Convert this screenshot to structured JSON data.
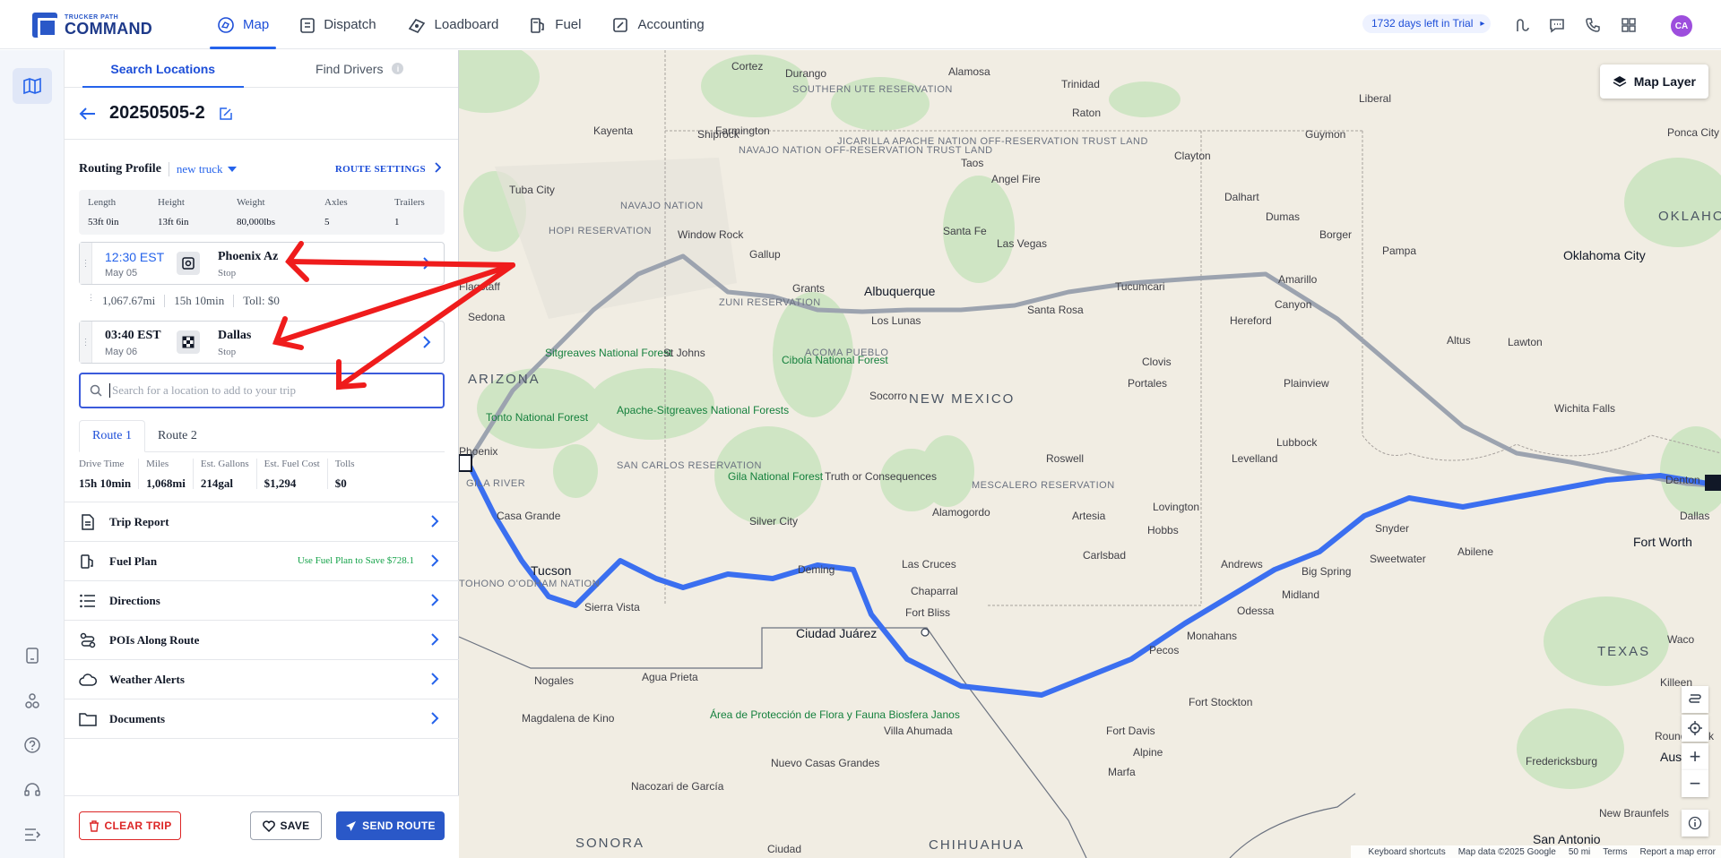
{
  "app": {
    "logo_small": "TRUCKER PATH",
    "logo_big": "COMMAND",
    "nav": [
      {
        "label": "Map"
      },
      {
        "label": "Dispatch"
      },
      {
        "label": "Loadboard"
      },
      {
        "label": "Fuel"
      },
      {
        "label": "Accounting"
      }
    ],
    "trial": "1732 days left in Trial",
    "avatar": "CA"
  },
  "panel": {
    "tabs": [
      "Search Locations",
      "Find Drivers"
    ],
    "trip_title": "20250505-2",
    "routing_profile_label": "Routing Profile",
    "routing_profile_value": "new truck",
    "route_settings": "ROUTE SETTINGS",
    "dims": [
      {
        "k": "Length",
        "v": "53ft 0in"
      },
      {
        "k": "Height",
        "v": "13ft 6in"
      },
      {
        "k": "Weight",
        "v": "80,000lbs"
      },
      {
        "k": "Axles",
        "v": "5"
      },
      {
        "k": "Trailers",
        "v": "1"
      }
    ],
    "stops": [
      {
        "time": "12:30 EST",
        "date": "May 05",
        "name": "Phoenix Az",
        "type": "Stop"
      },
      {
        "time": "03:40 EST",
        "date": "May 06",
        "name": "Dallas",
        "type": "Stop"
      }
    ],
    "leg": {
      "miles": "1,067.67mi",
      "time": "15h 10min",
      "toll": "Toll: $0"
    },
    "search_placeholder": "Search for a location to add to your trip",
    "route_tabs": [
      "Route 1",
      "Route 2"
    ],
    "summary": [
      {
        "k": "Drive Time",
        "v": "15h 10min"
      },
      {
        "k": "Miles",
        "v": "1,068mi"
      },
      {
        "k": "Est. Gallons",
        "v": "214gal"
      },
      {
        "k": "Est. Fuel Cost",
        "v": "$1,294"
      },
      {
        "k": "Tolls",
        "v": "$0"
      }
    ],
    "menu": [
      {
        "label": "Trip Report"
      },
      {
        "label": "Fuel Plan",
        "promo": "Use Fuel Plan to Save $728.1"
      },
      {
        "label": "Directions"
      },
      {
        "label": "POIs Along Route"
      },
      {
        "label": "Weather Alerts"
      },
      {
        "label": "Documents"
      }
    ],
    "buttons": {
      "clear": "CLEAR TRIP",
      "save": "SAVE",
      "send": "SEND ROUTE"
    }
  },
  "map": {
    "layer_button": "Map Layer",
    "labels": {
      "albuquerque": "Albuquerque",
      "new_mexico": "NEW MEXICO",
      "arizona": "ARIZONA",
      "texas": "TEXAS",
      "sonora": "SONORA",
      "chihuahua": "CHIHUAHUA",
      "oklahoma_city": "Oklahoma City",
      "oklahoma": "OKLAHOMA",
      "ciudad_juarez": "Ciudad Juárez",
      "tucson": "Tucson",
      "amarillo": "Amarillo",
      "lubbock": "Lubbock",
      "fort_worth": "Fort Worth",
      "austin": "Austin",
      "san_antonio": "San Antonio",
      "nogales": "Nogales",
      "santa_fe": "Santa Fe",
      "gallup": "Gallup",
      "deming": "Deming",
      "las_cruces": "Las Cruces",
      "roswell": "Roswell",
      "midland": "Midland",
      "odessa": "Odessa",
      "abilene": "Abilene",
      "el_paso_fb": "Fort Bliss",
      "gila": "Gila National Forest",
      "cibola": "Cibola National Forest",
      "apache": "Apache-Sitgreaves National Forests",
      "navajo": "NAVAJO NATION",
      "hopi": "HOPI RESERVATION",
      "acoma": "ACOMA PUEBLO",
      "zuni": "ZUNI RESERVATION",
      "mescalero": "MESCALERO RESERVATION",
      "san_carlos": "SAN CARLOS RESERVATION",
      "tonto": "Tonto National Forest",
      "sitgreaves": "Sitgreaves National Forest",
      "biosfera": "Área de Protección de Flora y Fauna Biosfera Janos",
      "wichita_falls": "Wichita Falls",
      "big_spring": "Big Spring",
      "sweetwater": "Sweetwater",
      "pecos": "Pecos",
      "monahans": "Monahans",
      "fort_stockton": "Fort Stockton",
      "fort_davis": "Fort Davis",
      "alpine": "Alpine",
      "marfa": "Marfa",
      "carlsbad": "Carlsbad",
      "hobbs": "Hobbs",
      "clovis": "Clovis",
      "portales": "Portales",
      "tucumcari": "Tucumcari",
      "santa_rosa": "Santa Rosa",
      "las_vegas": "Las Vegas",
      "socorro": "Socorro",
      "alamogordo": "Alamogordo",
      "truth_or_consequences": "Truth or Consequences",
      "silver_city": "Silver City",
      "sierra_vista": "Sierra Vista",
      "casa_grande": "Casa Grande",
      "sedona": "Sedona",
      "flagstaff": "Flagstaff",
      "farmington": "Farmington",
      "durango": "Durango",
      "trinidad": "Trinidad",
      "raton": "Raton",
      "taos": "Taos",
      "dalhart": "Dalhart",
      "dumas": "Dumas",
      "borger": "Borger",
      "pampa": "Pampa",
      "hereford": "Hereford",
      "canyon": "Canyon",
      "plainview": "Plainview",
      "levelland": "Levelland",
      "snyder": "Snyder",
      "andrews": "Andrews",
      "denton": "Denton",
      "waco": "Waco",
      "killeen": "Killeen",
      "round_rock": "Round Rock",
      "new_braunfels": "New Braunfels",
      "fredericksburg": "Fredericksburg",
      "lawton": "Lawton",
      "altus": "Altus",
      "guymon": "Guymon",
      "liberal": "Liberal",
      "clayton": "Clayton",
      "ponca_city": "Ponca City",
      "magdalena": "Magdalena de Kino",
      "nuevo_casas": "Nuevo Casas Grandes",
      "villa_ahumada": "Villa Ahumada",
      "agua_prieta": "Agua Prieta",
      "nacozari": "Nacozari de García",
      "ciudad": "Ciudad",
      "chaparral": "Chaparral",
      "los_lunas": "Los Lunas",
      "grants": "Grants",
      "window_rock": "Window Rock",
      "tuba_city": "Tuba City",
      "kayenta": "Kayenta",
      "shiprock": "Shiprock",
      "cortez": "Cortez",
      "alamosa": "Alamosa",
      "st_johns": "St Johns",
      "artesia": "Artesia",
      "lovington": "Lovington",
      "angel_fire": "Angel Fire",
      "jicarilla": "JICARILLA APACHE NATION OFF-RESERVATION TRUST LAND",
      "southern_ute": "SOUTHERN UTE RESERVATION",
      "navajo_nation_off": "NAVAJO NATION OFF-RESERVATION TRUST LAND",
      "tohono": "TOHONO O'ODHAM NATION",
      "gila_river": "GILA RIVER",
      "phoenix": "Phoenix",
      "dallas": "Dallas"
    },
    "attribution": [
      "Keyboard shortcuts",
      "Map data ©2025 Google",
      "50 mi",
      "Terms",
      "Report a map error"
    ]
  }
}
